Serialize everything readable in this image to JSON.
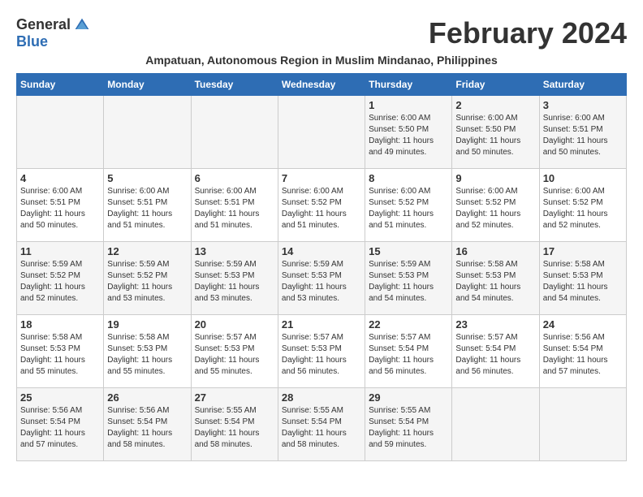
{
  "logo": {
    "general": "General",
    "blue": "Blue"
  },
  "title": "February 2024",
  "subtitle": "Ampatuan, Autonomous Region in Muslim Mindanao, Philippines",
  "headers": [
    "Sunday",
    "Monday",
    "Tuesday",
    "Wednesday",
    "Thursday",
    "Friday",
    "Saturday"
  ],
  "weeks": [
    [
      {
        "day": "",
        "info": ""
      },
      {
        "day": "",
        "info": ""
      },
      {
        "day": "",
        "info": ""
      },
      {
        "day": "",
        "info": ""
      },
      {
        "day": "1",
        "info": "Sunrise: 6:00 AM\nSunset: 5:50 PM\nDaylight: 11 hours and 49 minutes."
      },
      {
        "day": "2",
        "info": "Sunrise: 6:00 AM\nSunset: 5:50 PM\nDaylight: 11 hours and 50 minutes."
      },
      {
        "day": "3",
        "info": "Sunrise: 6:00 AM\nSunset: 5:51 PM\nDaylight: 11 hours and 50 minutes."
      }
    ],
    [
      {
        "day": "4",
        "info": "Sunrise: 6:00 AM\nSunset: 5:51 PM\nDaylight: 11 hours and 50 minutes."
      },
      {
        "day": "5",
        "info": "Sunrise: 6:00 AM\nSunset: 5:51 PM\nDaylight: 11 hours and 51 minutes."
      },
      {
        "day": "6",
        "info": "Sunrise: 6:00 AM\nSunset: 5:51 PM\nDaylight: 11 hours and 51 minutes."
      },
      {
        "day": "7",
        "info": "Sunrise: 6:00 AM\nSunset: 5:52 PM\nDaylight: 11 hours and 51 minutes."
      },
      {
        "day": "8",
        "info": "Sunrise: 6:00 AM\nSunset: 5:52 PM\nDaylight: 11 hours and 51 minutes."
      },
      {
        "day": "9",
        "info": "Sunrise: 6:00 AM\nSunset: 5:52 PM\nDaylight: 11 hours and 52 minutes."
      },
      {
        "day": "10",
        "info": "Sunrise: 6:00 AM\nSunset: 5:52 PM\nDaylight: 11 hours and 52 minutes."
      }
    ],
    [
      {
        "day": "11",
        "info": "Sunrise: 5:59 AM\nSunset: 5:52 PM\nDaylight: 11 hours and 52 minutes."
      },
      {
        "day": "12",
        "info": "Sunrise: 5:59 AM\nSunset: 5:52 PM\nDaylight: 11 hours and 53 minutes."
      },
      {
        "day": "13",
        "info": "Sunrise: 5:59 AM\nSunset: 5:53 PM\nDaylight: 11 hours and 53 minutes."
      },
      {
        "day": "14",
        "info": "Sunrise: 5:59 AM\nSunset: 5:53 PM\nDaylight: 11 hours and 53 minutes."
      },
      {
        "day": "15",
        "info": "Sunrise: 5:59 AM\nSunset: 5:53 PM\nDaylight: 11 hours and 54 minutes."
      },
      {
        "day": "16",
        "info": "Sunrise: 5:58 AM\nSunset: 5:53 PM\nDaylight: 11 hours and 54 minutes."
      },
      {
        "day": "17",
        "info": "Sunrise: 5:58 AM\nSunset: 5:53 PM\nDaylight: 11 hours and 54 minutes."
      }
    ],
    [
      {
        "day": "18",
        "info": "Sunrise: 5:58 AM\nSunset: 5:53 PM\nDaylight: 11 hours and 55 minutes."
      },
      {
        "day": "19",
        "info": "Sunrise: 5:58 AM\nSunset: 5:53 PM\nDaylight: 11 hours and 55 minutes."
      },
      {
        "day": "20",
        "info": "Sunrise: 5:57 AM\nSunset: 5:53 PM\nDaylight: 11 hours and 55 minutes."
      },
      {
        "day": "21",
        "info": "Sunrise: 5:57 AM\nSunset: 5:53 PM\nDaylight: 11 hours and 56 minutes."
      },
      {
        "day": "22",
        "info": "Sunrise: 5:57 AM\nSunset: 5:54 PM\nDaylight: 11 hours and 56 minutes."
      },
      {
        "day": "23",
        "info": "Sunrise: 5:57 AM\nSunset: 5:54 PM\nDaylight: 11 hours and 56 minutes."
      },
      {
        "day": "24",
        "info": "Sunrise: 5:56 AM\nSunset: 5:54 PM\nDaylight: 11 hours and 57 minutes."
      }
    ],
    [
      {
        "day": "25",
        "info": "Sunrise: 5:56 AM\nSunset: 5:54 PM\nDaylight: 11 hours and 57 minutes."
      },
      {
        "day": "26",
        "info": "Sunrise: 5:56 AM\nSunset: 5:54 PM\nDaylight: 11 hours and 58 minutes."
      },
      {
        "day": "27",
        "info": "Sunrise: 5:55 AM\nSunset: 5:54 PM\nDaylight: 11 hours and 58 minutes."
      },
      {
        "day": "28",
        "info": "Sunrise: 5:55 AM\nSunset: 5:54 PM\nDaylight: 11 hours and 58 minutes."
      },
      {
        "day": "29",
        "info": "Sunrise: 5:55 AM\nSunset: 5:54 PM\nDaylight: 11 hours and 59 minutes."
      },
      {
        "day": "",
        "info": ""
      },
      {
        "day": "",
        "info": ""
      }
    ]
  ]
}
